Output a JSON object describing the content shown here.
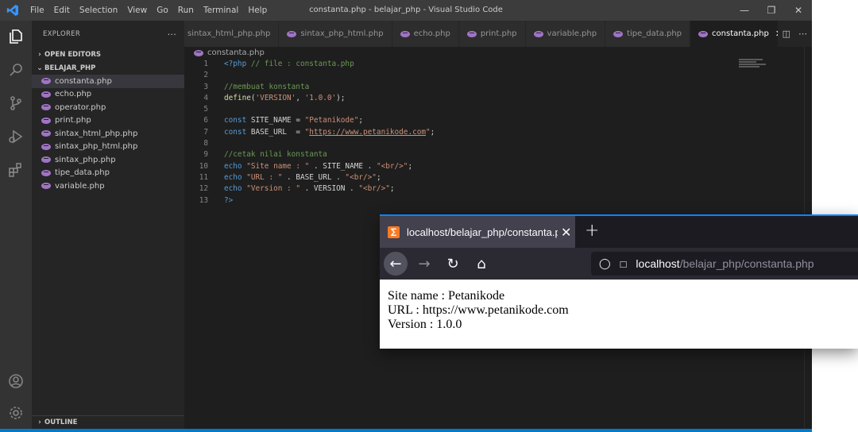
{
  "vscode": {
    "title": "constanta.php - belajar_php - Visual Studio Code",
    "menu": [
      "File",
      "Edit",
      "Selection",
      "View",
      "Go",
      "Run",
      "Terminal",
      "Help"
    ],
    "sidebar": {
      "header": "EXPLORER",
      "more": "···",
      "open_editors": "OPEN EDITORS",
      "project": "BELAJAR_PHP",
      "files": [
        "constanta.php",
        "echo.php",
        "operator.php",
        "print.php",
        "sintax_html_php.php",
        "sintax_php_html.php",
        "sintax_php.php",
        "tipe_data.php",
        "variable.php"
      ],
      "active_file": "constanta.php",
      "outline": "OUTLINE"
    },
    "tabs": [
      "sintax_html_php.php",
      "sintax_php_html.php",
      "echo.php",
      "print.php",
      "variable.php",
      "tipe_data.php",
      "constanta.php"
    ],
    "active_tab": "constanta.php",
    "breadcrumb": "constanta.php",
    "code": {
      "lines": [
        {
          "n": "1",
          "t": "<?php // file : constanta.php"
        },
        {
          "n": "2",
          "t": ""
        },
        {
          "n": "3",
          "t": "//membuat konstanta"
        },
        {
          "n": "4",
          "t": "define('VERSION', '1.0.0');"
        },
        {
          "n": "5",
          "t": ""
        },
        {
          "n": "6",
          "t": "const SITE_NAME = \"Petanikode\";"
        },
        {
          "n": "7",
          "t": "const BASE_URL  = \"https://www.petanikode.com\";"
        },
        {
          "n": "8",
          "t": ""
        },
        {
          "n": "9",
          "t": "//cetak nilai konstanta"
        },
        {
          "n": "10",
          "t": "echo \"Site name : \" . SITE_NAME . \"<br/>\";"
        },
        {
          "n": "11",
          "t": "echo \"URL : \" . BASE_URL . \"<br/>\";"
        },
        {
          "n": "12",
          "t": "echo \"Version : \" . VERSION . \"<br/>\";"
        },
        {
          "n": "13",
          "t": "?>"
        }
      ]
    },
    "colors": {
      "accent": "#007acc",
      "titlebar": "#3c3c3c",
      "editor_bg": "#1e1e1e"
    }
  },
  "browser": {
    "tab_title": "localhost/belajar_php/constanta.php",
    "url_host": "localhost",
    "url_path": "/belajar_php/constanta.php",
    "output": [
      "Site name : Petanikode",
      "URL : https://www.petanikode.com",
      "Version : 1.0.0"
    ],
    "colors": {
      "accent": "#0a84ff",
      "favicon": "#fb7a24"
    }
  }
}
